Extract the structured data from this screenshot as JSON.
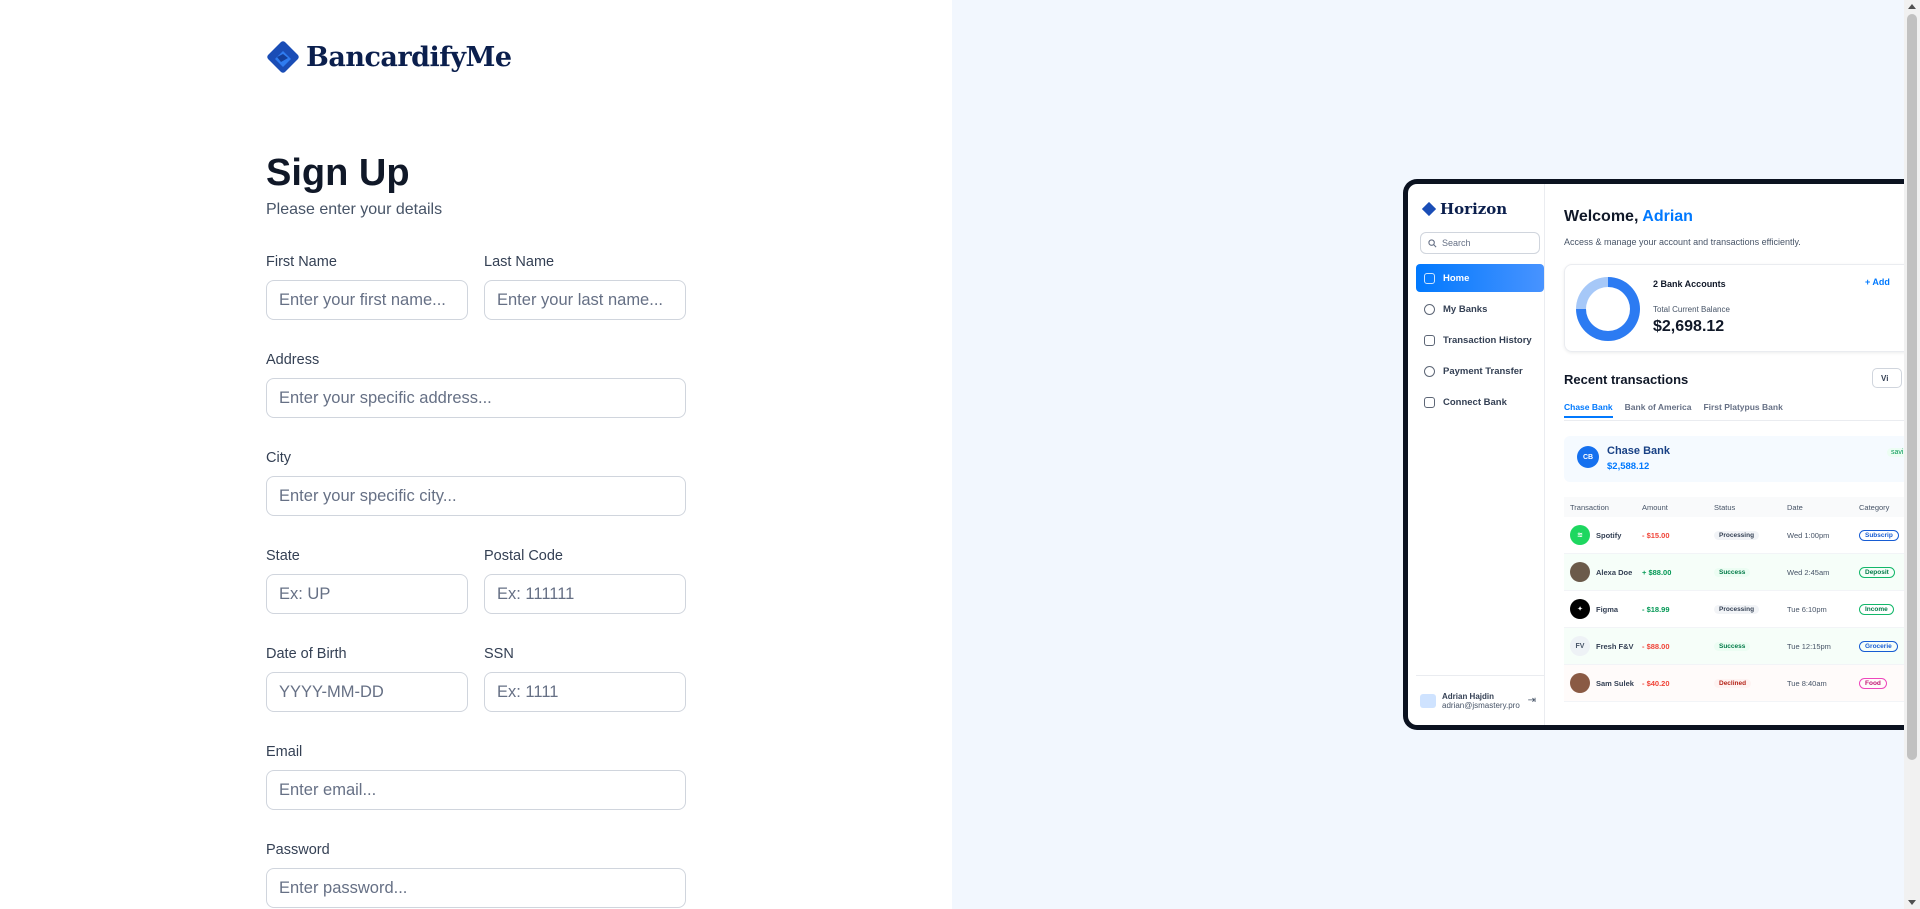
{
  "brand": {
    "name": "BancardifyMe",
    "icon": "diamond-logo-icon",
    "color": "#0b1f4d"
  },
  "form": {
    "title": "Sign Up",
    "subtitle": "Please enter your details",
    "first_name": {
      "label": "First Name",
      "placeholder": "Enter your first name..."
    },
    "last_name": {
      "label": "Last Name",
      "placeholder": "Enter your last name..."
    },
    "address": {
      "label": "Address",
      "placeholder": "Enter your specific address..."
    },
    "city": {
      "label": "City",
      "placeholder": "Enter your specific city..."
    },
    "state": {
      "label": "State",
      "placeholder": "Ex: UP"
    },
    "postal_code": {
      "label": "Postal Code",
      "placeholder": "Ex: 111111"
    },
    "dob": {
      "label": "Date of Birth",
      "placeholder": "YYYY-MM-DD"
    },
    "ssn": {
      "label": "SSN",
      "placeholder": "Ex: 1111"
    },
    "email": {
      "label": "Email",
      "placeholder": "Enter email..."
    },
    "password": {
      "label": "Password",
      "placeholder": "Enter password..."
    }
  },
  "preview": {
    "app_name": "Horizon",
    "search_placeholder": "Search",
    "nav": [
      {
        "label": "Home",
        "icon": "home-icon",
        "active": true
      },
      {
        "label": "My Banks",
        "icon": "dollar-circle-icon"
      },
      {
        "label": "Transaction History",
        "icon": "receipt-icon"
      },
      {
        "label": "Payment Transfer",
        "icon": "money-send-icon"
      },
      {
        "label": "Connect Bank",
        "icon": "card-icon"
      }
    ],
    "user": {
      "name": "Adrian Hajdin",
      "email": "adrian@jsmastery.pro"
    },
    "welcome_prefix": "Welcome,",
    "welcome_name": "Adrian",
    "description": "Access & manage your account and transactions efficiently.",
    "accounts_label": "2 Bank Accounts",
    "add_label": "+ Add",
    "balance_label": "Total Current Balance",
    "balance": "$2,698.12",
    "recent_title": "Recent transactions",
    "view_all": "Vi",
    "tabs": [
      "Chase Bank",
      "Bank of America",
      "First Platypus Bank"
    ],
    "bank_card": {
      "initials": "CB",
      "name": "Chase Bank",
      "balance": "$2,588.12",
      "type": "savi"
    },
    "table_headers": [
      "Transaction",
      "Amount",
      "Status",
      "Date",
      "Category"
    ],
    "transactions": [
      {
        "name": "Spotify",
        "amount": "- $15.00",
        "status": "Processing",
        "date": "Wed 1:00pm",
        "category": "Subscrip"
      },
      {
        "name": "Alexa Doe",
        "amount": "+ $88.00",
        "status": "Success",
        "date": "Wed 2:45am",
        "category": "Deposit"
      },
      {
        "name": "Figma",
        "amount": "- $18.99",
        "status": "Processing",
        "date": "Tue 6:10pm",
        "category": "Income"
      },
      {
        "name": "Fresh F&V",
        "amount": "- $88.00",
        "status": "Success",
        "date": "Tue 12:15pm",
        "category": "Grocerie"
      },
      {
        "name": "Sam Sulek",
        "amount": "- $40.20",
        "status": "Declined",
        "date": "Tue 8:40am",
        "category": "Food"
      }
    ],
    "avatar_initials": {
      "fresh": "FV"
    }
  },
  "colors": {
    "accent": "#0179fe",
    "right_bg": "#f2f7fe"
  }
}
